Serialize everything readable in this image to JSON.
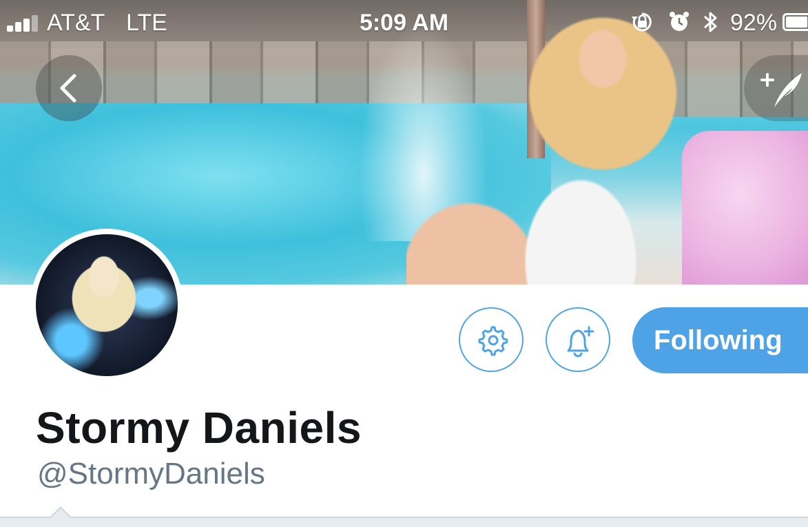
{
  "status_bar": {
    "carrier": "AT&T",
    "network": "LTE",
    "time": "5:09 AM",
    "battery_percent": "92%",
    "battery_level": 0.92,
    "icons": [
      "signal-icon",
      "orientation-lock-icon",
      "alarm-icon",
      "bluetooth-icon",
      "battery-icon"
    ]
  },
  "header": {
    "back_icon": "chevron-left-icon",
    "compose_icon": "compose-tweet-icon"
  },
  "profile": {
    "display_name": "Stormy Daniels",
    "handle": "@StormyDaniels"
  },
  "actions": {
    "settings_icon": "gear-icon",
    "notify_icon": "bell-plus-icon",
    "following_label": "Following"
  },
  "colors": {
    "accent": "#4da3e6",
    "name_text": "#14171a",
    "handle_text": "#657786"
  }
}
